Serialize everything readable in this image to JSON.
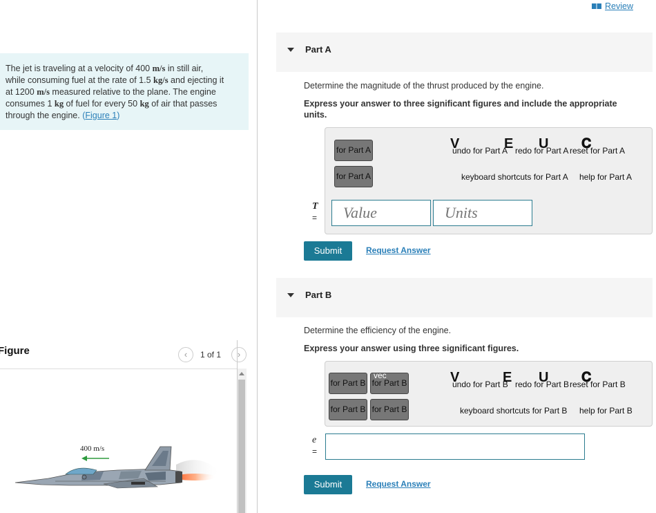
{
  "review": {
    "label": "Review"
  },
  "problem": {
    "line1_pre": "The jet is traveling at a velocity of 400 ",
    "line1_unit": "m/s",
    "line1_post": " in still air,",
    "line2_pre": "while consuming fuel at the rate of 1.5 ",
    "line2_unit": "kg/s",
    "line2_post": " and ejecting it",
    "line3_pre": "at 1200 ",
    "line3_unit": "m/s",
    "line3_post": " measured relative to the plane. The engine",
    "line4_pre": "consumes 1 ",
    "line4_unit": "kg",
    "line4_mid": " of fuel for every 50 ",
    "line4_unit2": "kg",
    "line4_post": " of air that passes",
    "line5_pre": "through the engine. ",
    "figure_link": "Figure 1",
    "paren_open": "(",
    "paren_close": ")"
  },
  "figure": {
    "label": "Figure",
    "count": "1 of 1",
    "velocity_label": "400 m/s"
  },
  "partA": {
    "title": "Part A",
    "question": "Determine the magnitude of the thrust produced by the engine.",
    "instruction": "Express your answer to three significant figures and include the appropriate units.",
    "btn1": "for Part A",
    "btn2": "for Part A",
    "undo": "undo for Part A",
    "redo": "redo for Part A",
    "reset": "reset for Part A",
    "shortcuts": "keyboard shortcuts for Part A",
    "help": "help for Part A",
    "var": "T",
    "eq": "=",
    "value_placeholder": "Value",
    "units_placeholder": "Units",
    "submit": "Submit",
    "request": "Request Answer"
  },
  "partB": {
    "title": "Part B",
    "question": "Determine the efficiency of the engine.",
    "instruction": "Express your answer using three significant figures.",
    "btn1": "for Part B",
    "btn2": "for Part B",
    "btn3": "for Part B",
    "btn4": "for Part B",
    "btn2_top": "vec",
    "undo": "undo for Part B",
    "redo": "redo for Part B",
    "reset": "reset for Part B",
    "shortcuts": "keyboard shortcuts for Part B",
    "help": "help for Part B",
    "var": "e",
    "eq": "=",
    "submit": "Submit",
    "request": "Request Answer"
  },
  "colors": {
    "accent": "#1b7a95",
    "link": "#2a7fb8",
    "problem_bg": "#e7f5f7"
  },
  "icons": [
    "book-icon",
    "chevron-left-icon",
    "chevron-right-icon",
    "caret-down-icon",
    "jet-illustration",
    "arrow-left-icon"
  ]
}
